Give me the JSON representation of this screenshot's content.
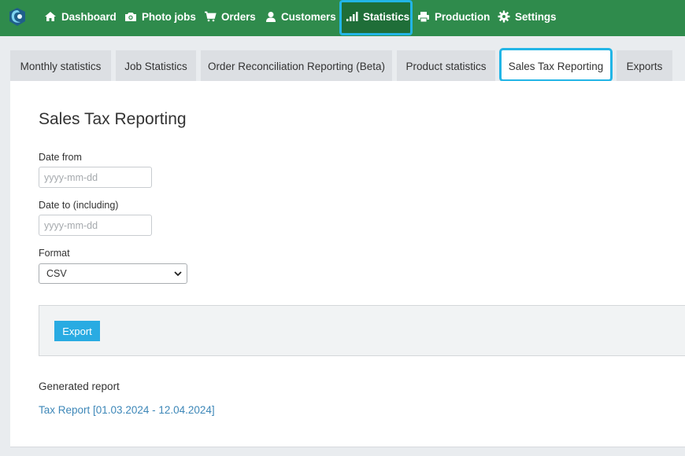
{
  "nav": {
    "items": [
      {
        "label": "Dashboard",
        "icon": "home-icon"
      },
      {
        "label": "Photo jobs",
        "icon": "camera-icon"
      },
      {
        "label": "Orders",
        "icon": "cart-icon"
      },
      {
        "label": "Customers",
        "icon": "user-icon"
      },
      {
        "label": "Statistics",
        "icon": "bar-chart-icon"
      },
      {
        "label": "Production",
        "icon": "printer-icon"
      },
      {
        "label": "Settings",
        "icon": "gear-icon"
      }
    ],
    "active": "Statistics"
  },
  "tabs": [
    {
      "label": "Monthly statistics"
    },
    {
      "label": "Job Statistics"
    },
    {
      "label": "Order Reconciliation Reporting (Beta)"
    },
    {
      "label": "Product statistics"
    },
    {
      "label": "Sales Tax Reporting"
    },
    {
      "label": "Exports"
    }
  ],
  "active_tab": "Sales Tax Reporting",
  "form": {
    "title": "Sales Tax Reporting",
    "date_from_label": "Date from",
    "date_from_placeholder": "yyyy-mm-dd",
    "date_to_label": "Date to (including)",
    "date_to_placeholder": "yyyy-mm-dd",
    "format_label": "Format",
    "format_value": "CSV",
    "export_label": "Export"
  },
  "generated": {
    "title": "Generated report",
    "link": "Tax Report [01.03.2024 - 12.04.2024]"
  },
  "colors": {
    "nav_bg": "#2f8b4c",
    "highlight": "#22b5e6",
    "button": "#29abe2",
    "link": "#3d87b8"
  }
}
